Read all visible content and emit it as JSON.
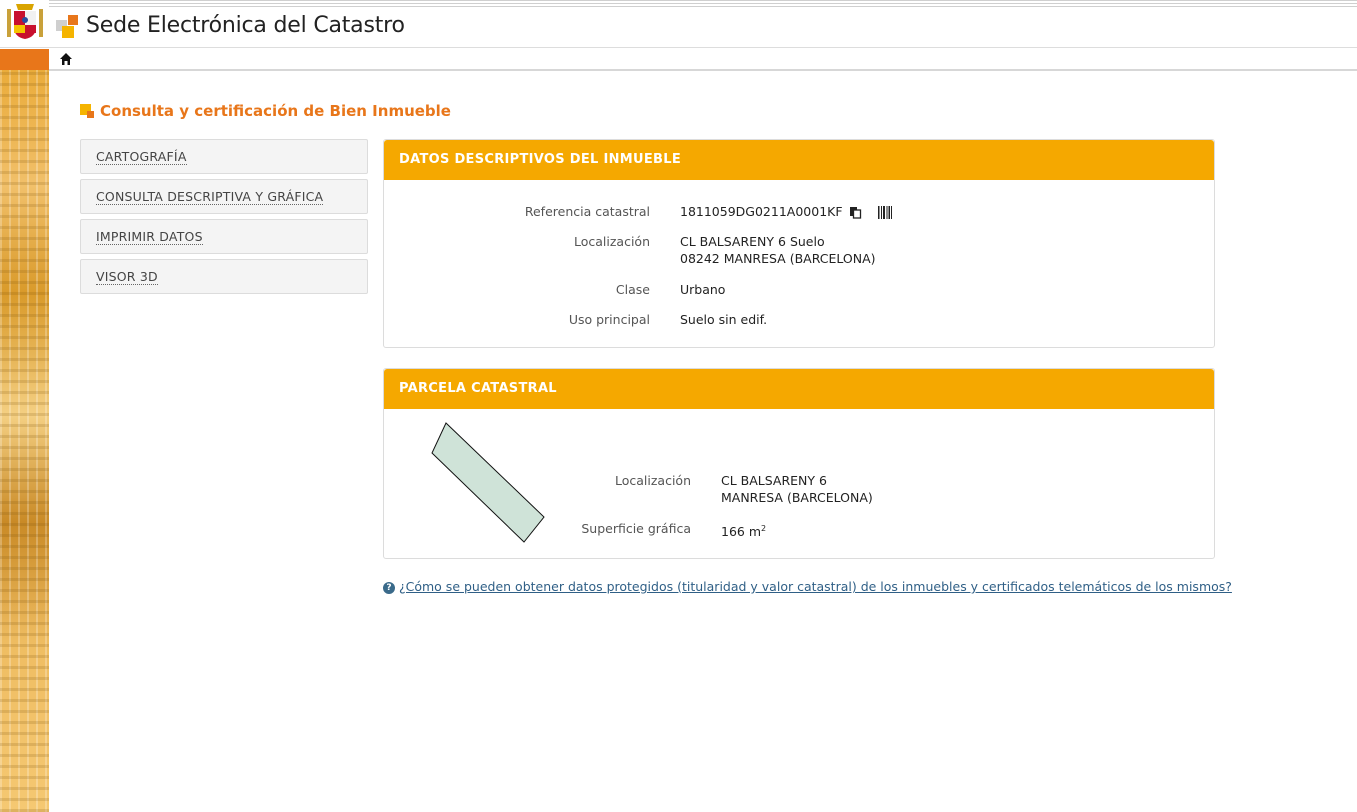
{
  "header": {
    "site_title": "Sede Electrónica del Catastro"
  },
  "page": {
    "title": "Consulta y certificación de Bien Inmueble"
  },
  "menu": {
    "items": [
      {
        "label": "CARTOGRAFÍA"
      },
      {
        "label": "CONSULTA DESCRIPTIVA Y GRÁFICA"
      },
      {
        "label": "IMPRIMIR DATOS"
      },
      {
        "label": "VISOR 3D"
      }
    ]
  },
  "datos": {
    "heading": "DATOS DESCRIPTIVOS DEL INMUEBLE",
    "ref_label": "Referencia catastral",
    "ref_value": "1811059DG0211A0001KF",
    "loc_label": "Localización",
    "loc_line1": "CL BALSARENY 6 Suelo",
    "loc_line2": "08242 MANRESA (BARCELONA)",
    "clase_label": "Clase",
    "clase_value": "Urbano",
    "uso_label": "Uso principal",
    "uso_value": "Suelo sin edif."
  },
  "parcela": {
    "heading": "PARCELA CATASTRAL",
    "loc_label": "Localización",
    "loc_line1": "CL BALSARENY 6",
    "loc_line2": "MANRESA (BARCELONA)",
    "sup_label": "Superficie gráfica",
    "sup_value": "166 m",
    "sup_exp": "2"
  },
  "help": {
    "text": "¿Cómo se pueden obtener datos protegidos (titularidad y valor catastral) de los inmuebles y certificados telemáticos de los mismos?"
  },
  "colors": {
    "accent_orange": "#e8761a",
    "panel_header": "#f5a800",
    "link": "#2f5f86"
  }
}
